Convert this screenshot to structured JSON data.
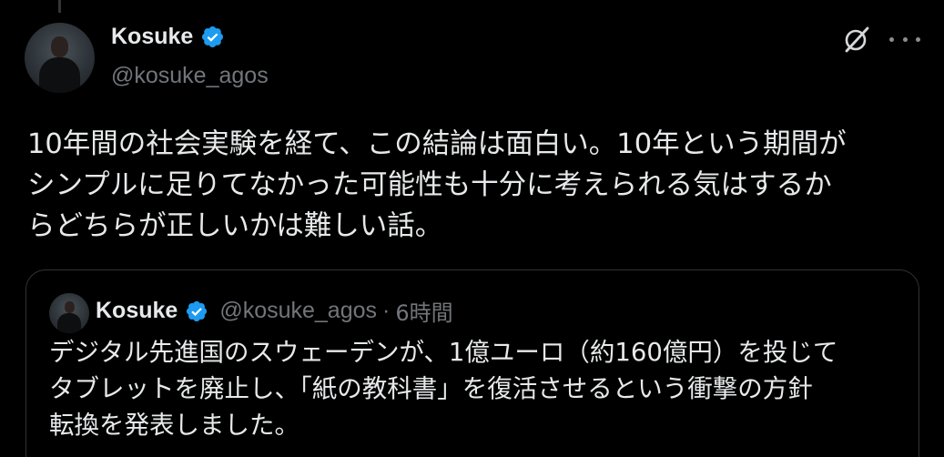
{
  "tweet": {
    "author": {
      "name": "Kosuke",
      "handle": "@kosuke_agos",
      "verified": true
    },
    "text": "10年間の社会実験を経て、この結論は面白い。10年という期間が\nシンプルに足りてなかった可能性も十分に考えられる気はするか\nらどちらが正しいかは難しい話。",
    "icons": {
      "grok": "grok-icon",
      "more": "more-icon"
    }
  },
  "quote": {
    "author": {
      "name": "Kosuke",
      "handle": "@kosuke_agos",
      "verified": true
    },
    "separator": "·",
    "time": "6時間",
    "text": "デジタル先進国のスウェーデンが、1億ユーロ（約160億円）を投じて\nタブレットを廃止し、「紙の教科書」を復活させるという衝撃の方針\n転換を発表しました。"
  },
  "colors": {
    "background": "#000000",
    "text": "#e7e9ea",
    "secondary": "#71767b",
    "verified": "#1d9bf0",
    "border": "#2f3336"
  }
}
